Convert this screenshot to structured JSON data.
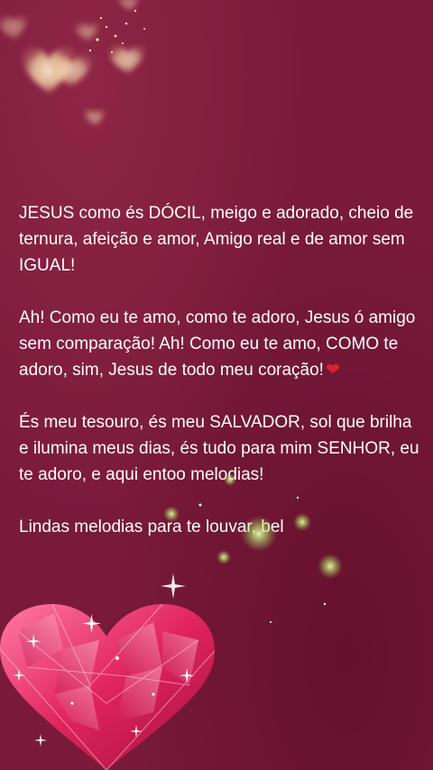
{
  "message": {
    "paragraph1": "JESUS como és DÓCIL, meigo e adorado, cheio de ternura, afeição e amor, Amigo real e de amor sem IGUAL!",
    "paragraph2": "Ah! Como eu te amo, como te adoro, Jesus ó amigo sem comparação! Ah! Como eu te amo, COMO te adoro, sim, Jesus de todo meu coração!",
    "paragraph2_emoji": "❤",
    "paragraph3": "És meu tesouro, és meu SALVADOR, sol que brilha e ilumina meus dias, és tudo para mim SENHOR, eu te adoro, e aqui entoo melodias!",
    "paragraph4": "Lindas melodias para te louvar, bel"
  },
  "colors": {
    "background": "#7a1a3b",
    "text": "#ffffff",
    "heart_gem": "#e0245e",
    "emoji_heart": "#e01e37"
  },
  "icons": {
    "top_decoration": "glowing-hearts-icon",
    "bottom_decoration": "gem-heart-icon"
  }
}
